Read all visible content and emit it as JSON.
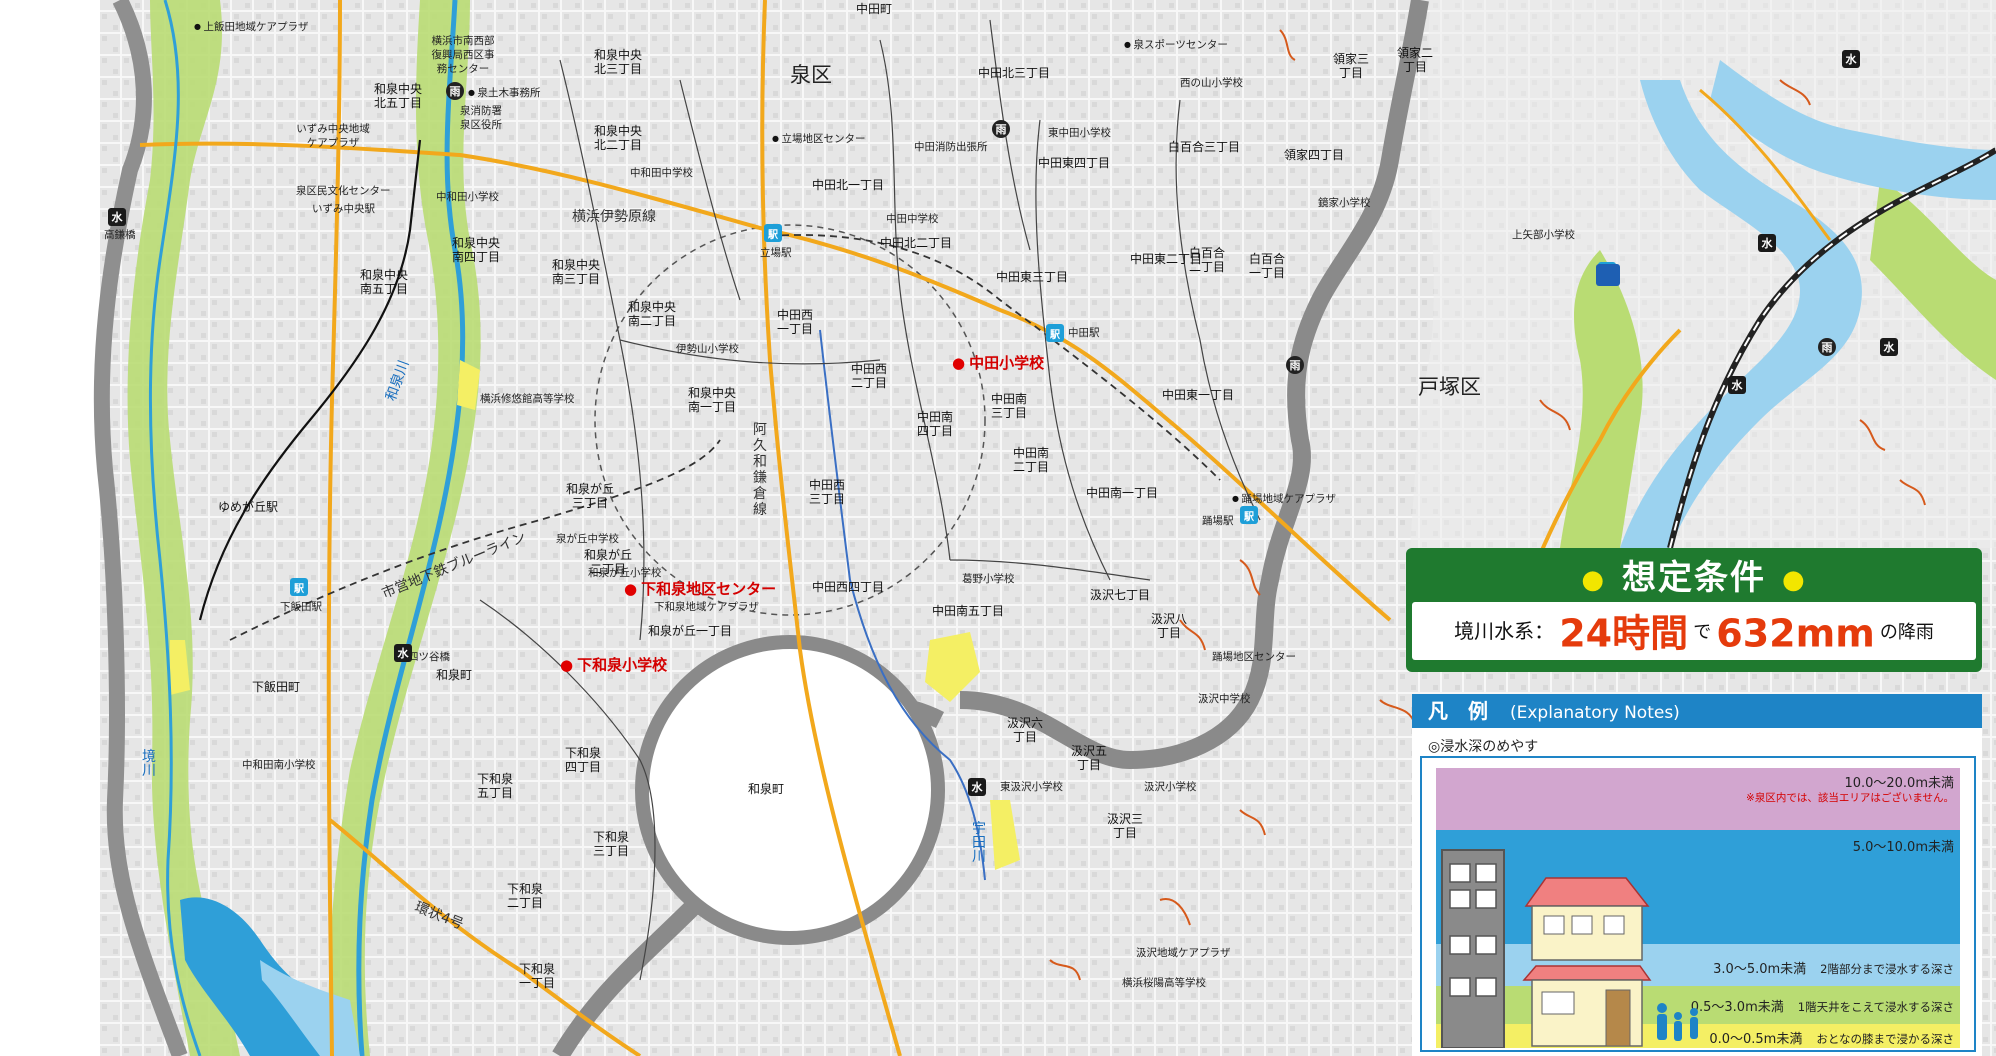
{
  "ward_labels": {
    "izumi": "泉区",
    "totsuka": "戸塚区"
  },
  "districts": [
    "中田町",
    "和泉中央北三丁目",
    "和泉中央北五丁目",
    "和泉中央北二丁目",
    "中和田中学校",
    "和泉中央南四丁目",
    "和泉中央南三丁目",
    "和泉中央南五丁目",
    "和泉中央南二丁目",
    "和泉中央南一丁目",
    "和泉が丘三丁目",
    "和泉が丘二丁目",
    "和泉が丘一丁目",
    "下和泉五丁目",
    "下和泉四丁目",
    "下和泉三丁目",
    "下和泉二丁目",
    "下和泉一丁目",
    "和泉町",
    "中田北三丁目",
    "中田東四丁目",
    "中田北一丁目",
    "中田北二丁目",
    "中田東三丁目",
    "中田西一丁目",
    "中田西二丁目",
    "中田西三丁目",
    "中田西四丁目",
    "中田南四丁目",
    "中田南三丁目",
    "中田南二丁目",
    "中田南一丁目",
    "中田南五丁目",
    "中田東二丁目",
    "中田東一丁目",
    "白百合三丁目",
    "白百合二丁目",
    "白百合一丁目",
    "領家三丁目",
    "領家二丁目",
    "領家四丁目",
    "汲沢七丁目",
    "汲沢八丁目",
    "汲沢六丁目",
    "汲沢五丁目",
    "汲沢三丁目",
    "下飯田町",
    "和泉町"
  ],
  "facilities": [
    "上飯田地域ケアプラザ",
    "横浜市南西部復興局西区事務センター",
    "泉土木事務所",
    "泉消防署",
    "泉区役所",
    "いずみ中央地域ケアプラザ",
    "泉区民文化センター",
    "いずみ中央駅",
    "中和田小学校",
    "立場地区センター",
    "中田消防出張所",
    "東中田小学校",
    "西の山小学校",
    "泉スポーツセンター",
    "鏡家小学校",
    "中田中学校",
    "伊勢山小学校",
    "横浜修悠館高等学校",
    "泉が丘中学校",
    "和泉が丘小学校",
    "下和泉地域ケアプラザ",
    "葛野小学校",
    "中和田南小学校",
    "四ツ谷橋",
    "高鎌橋",
    "ゆめが丘駅",
    "下飯田駅",
    "立場駅",
    "中田駅",
    "踊場駅",
    "踊場地域ケアプラザ",
    "汲沢地域ケアプラザ",
    "上矢部小学校",
    "横浜桜陽高等学校",
    "汲沢小学校",
    "東汲沢小学校",
    "汲沢中学校",
    "踊場地区センター"
  ],
  "railways": {
    "blue_line": "市営地下鉄ブルーライン",
    "ise_road": "横浜伊勢原線",
    "kamakura_road": "阿久和鎌倉線",
    "ring4": "環状4号",
    "izumi_river": "和泉川",
    "sakai_river": "境川",
    "uta_river": "宇田川"
  },
  "highlight_points": [
    {
      "id": "nakada-es",
      "label": "中田小学校"
    },
    {
      "id": "shimo-center",
      "label": "下和泉地区センター"
    },
    {
      "id": "shimo-es",
      "label": "下和泉小学校"
    }
  ],
  "condition": {
    "title": "想定条件",
    "prefix": "境川水系：",
    "hours": "24時間",
    "mid": "で",
    "amount": "632mm",
    "suffix": "の降雨"
  },
  "legend": {
    "title": "凡　例",
    "title_en": "(Explanatory Notes)",
    "subtitle": "◎浸水深のめやす",
    "bands": [
      {
        "range": "10.0～20.0m未満",
        "desc": "",
        "note": "※泉区内では、該当エリアはございません。",
        "color": "#d2a6cf"
      },
      {
        "range": "5.0～10.0m未満",
        "desc": "",
        "note": "",
        "color": "#2f9fd8"
      },
      {
        "range": "3.0～5.0m未満",
        "desc": "2階部分まで浸水する深さ",
        "note": "",
        "color": "#9bd2ef"
      },
      {
        "range": "0.5～3.0m未満",
        "desc": "1階天井をこえて浸水する深さ",
        "note": "",
        "color": "#b9dc73"
      },
      {
        "range": "0.0～0.5m未満",
        "desc": "おとなの膝まで浸かる深さ",
        "note": "",
        "color": "#f4ef64"
      }
    ]
  },
  "colors": {
    "flood_yellow": "#f4ef64",
    "flood_green": "#b9dc73",
    "flood_lightblue": "#9bd2ef",
    "flood_blue": "#2f9fd8",
    "road_orange": "#f2a81c",
    "boundary_gray": "#8a8a8a"
  },
  "map_icons": {
    "rain": "雨",
    "water": "水",
    "station": "駅"
  }
}
